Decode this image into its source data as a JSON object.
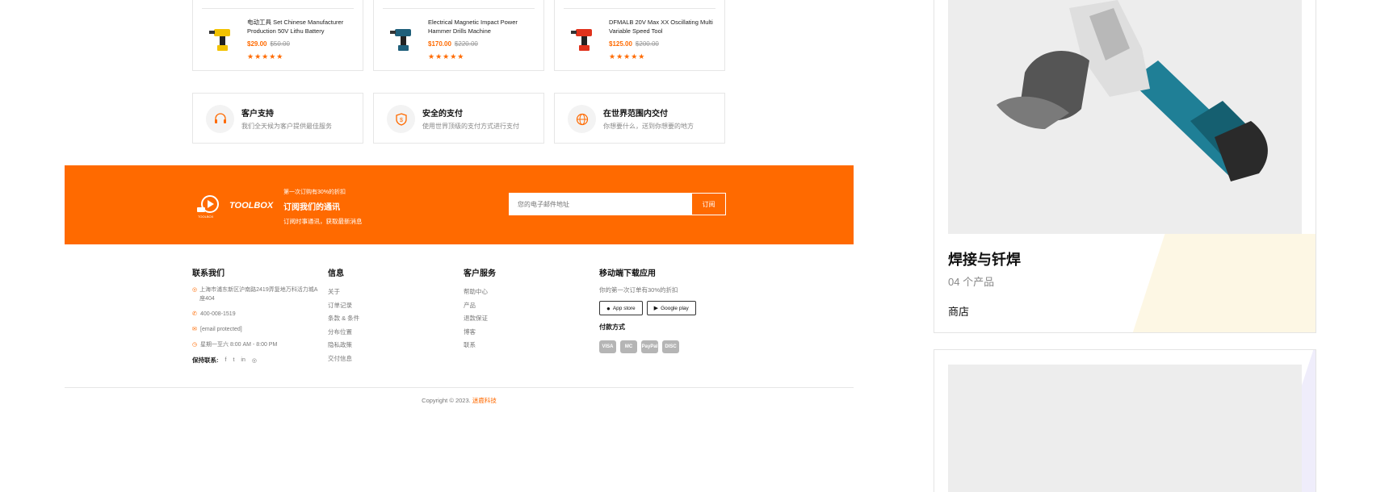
{
  "products": [
    {
      "title": "电动工具 Set Chinese Manufacturer Production 50V Lithu Battery",
      "price": "$29.00",
      "old_price": "$50.00",
      "stars": "★★★★★",
      "thumb_icon": "yellow-drill-icon",
      "thumb_color": "#f2c200"
    },
    {
      "title": "Electrical Magnetic Impact Power Hammer Drills Machine",
      "price": "$170.00",
      "old_price": "$220.00",
      "stars": "★★★★★",
      "thumb_icon": "blue-drill-icon",
      "thumb_color": "#1f5f7a"
    },
    {
      "title": "DFMALB 20V Max XX Oscillating Multi Variable Speed Tool",
      "price": "$125.00",
      "old_price": "$200.00",
      "stars": "★★★★★",
      "thumb_icon": "red-drill-icon",
      "thumb_color": "#e0321c"
    }
  ],
  "features": [
    {
      "title": "客户支持",
      "subtitle": "我们全天候为客户提供最佳服务",
      "icon": "headset-icon"
    },
    {
      "title": "安全的支付",
      "subtitle": "使用世界顶级的支付方式进行支付",
      "icon": "shield-icon"
    },
    {
      "title": "在世界范围内交付",
      "subtitle": "你想要什么，送到你想要的地方",
      "icon": "globe-icon"
    }
  ],
  "newsletter": {
    "logo_text": "TOOLBOX",
    "logo_small": "TOOLBOX",
    "promo": "第一次订购有30%的折扣",
    "heading": "订阅我们的通讯",
    "subheading": "订阅时事通讯，获取最新消息",
    "placeholder": "您的电子邮件地址",
    "button": "订阅",
    "accent": "#ff6a00"
  },
  "footer": {
    "contact": {
      "heading": "联系我们",
      "address": "上海市浦东新区沪南路2419弄复地万科活力城A座404",
      "phone": "400-008-1519",
      "email": "[email protected]",
      "hours": "星期一至六 8:00 AM - 8:00 PM",
      "social_label": "保持联系:",
      "social": [
        "f",
        "t",
        "in",
        "◎"
      ]
    },
    "info": {
      "heading": "信息",
      "links": [
        "关于",
        "订单记录",
        "条款 & 条件",
        "分布位置",
        "隐私政策",
        "交付信息"
      ]
    },
    "service": {
      "heading": "客户服务",
      "links": [
        "帮助中心",
        "产品",
        "退款保证",
        "博客",
        "联系"
      ]
    },
    "app": {
      "heading": "移动端下载应用",
      "subtitle": "你的第一次订单有30%的折扣",
      "app_store": "App store",
      "google_play": "Google play",
      "payment_heading": "付款方式",
      "payments": [
        "VISA",
        "MC",
        "PayPal",
        "DISC"
      ]
    },
    "copyright": "Copyright © 2023.",
    "brand": "迷鹿科技"
  },
  "side": {
    "category": "焊接与钎焊",
    "count": "04 个产品",
    "shop": "商店"
  }
}
